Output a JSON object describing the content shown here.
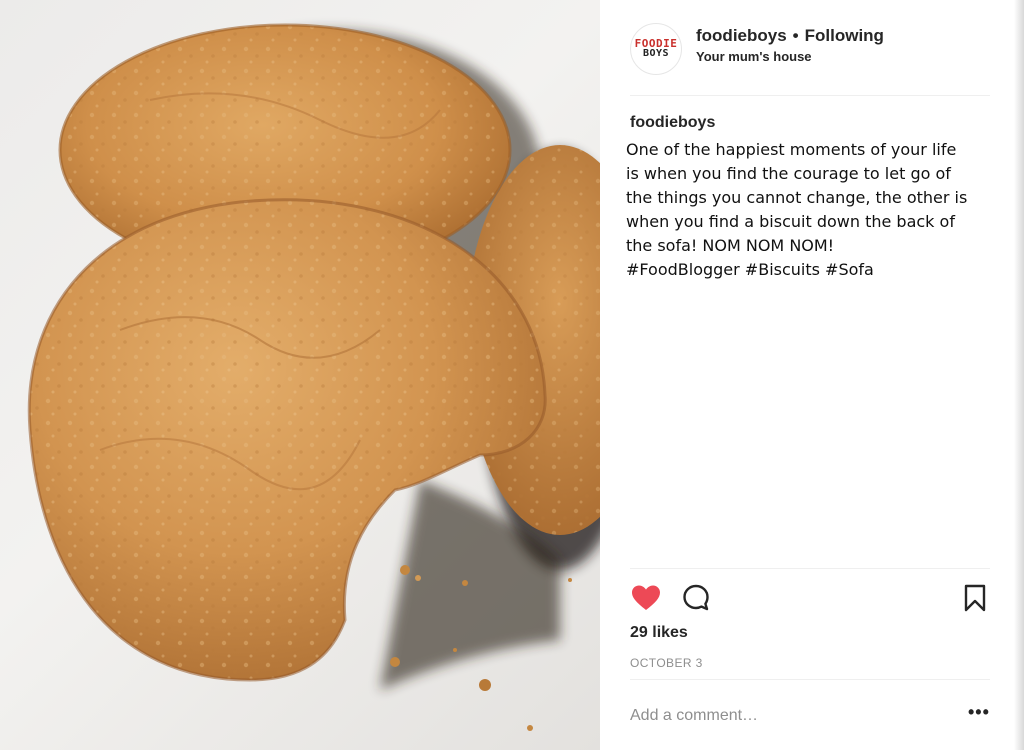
{
  "post": {
    "username": "foodieboys",
    "separator": "•",
    "follow_status": "Following",
    "location": "Your mum's house",
    "avatar": {
      "line1": "FOODIE",
      "line2": "BOYS"
    },
    "caption_user": "foodieboys",
    "caption_text": "One of the happiest moments of your life\nis when you find the courage to let go of\nthe things you cannot change, the other is\nwhen you find a biscuit down the back of\nthe sofa! NOM NOM NOM!\n#FoodBlogger #Biscuits #Sofa",
    "likes": "29 likes",
    "date": "OCTOBER 3",
    "comment_placeholder": "Add a comment…",
    "more_label": "•••"
  },
  "icons": {
    "like": "heart-icon",
    "comment": "comment-icon",
    "save": "bookmark-icon",
    "more": "more-options-icon"
  },
  "colors": {
    "heart": "#ed4956",
    "text": "#262626",
    "muted": "#8e8e8e",
    "biscuit": "#c98a45"
  }
}
